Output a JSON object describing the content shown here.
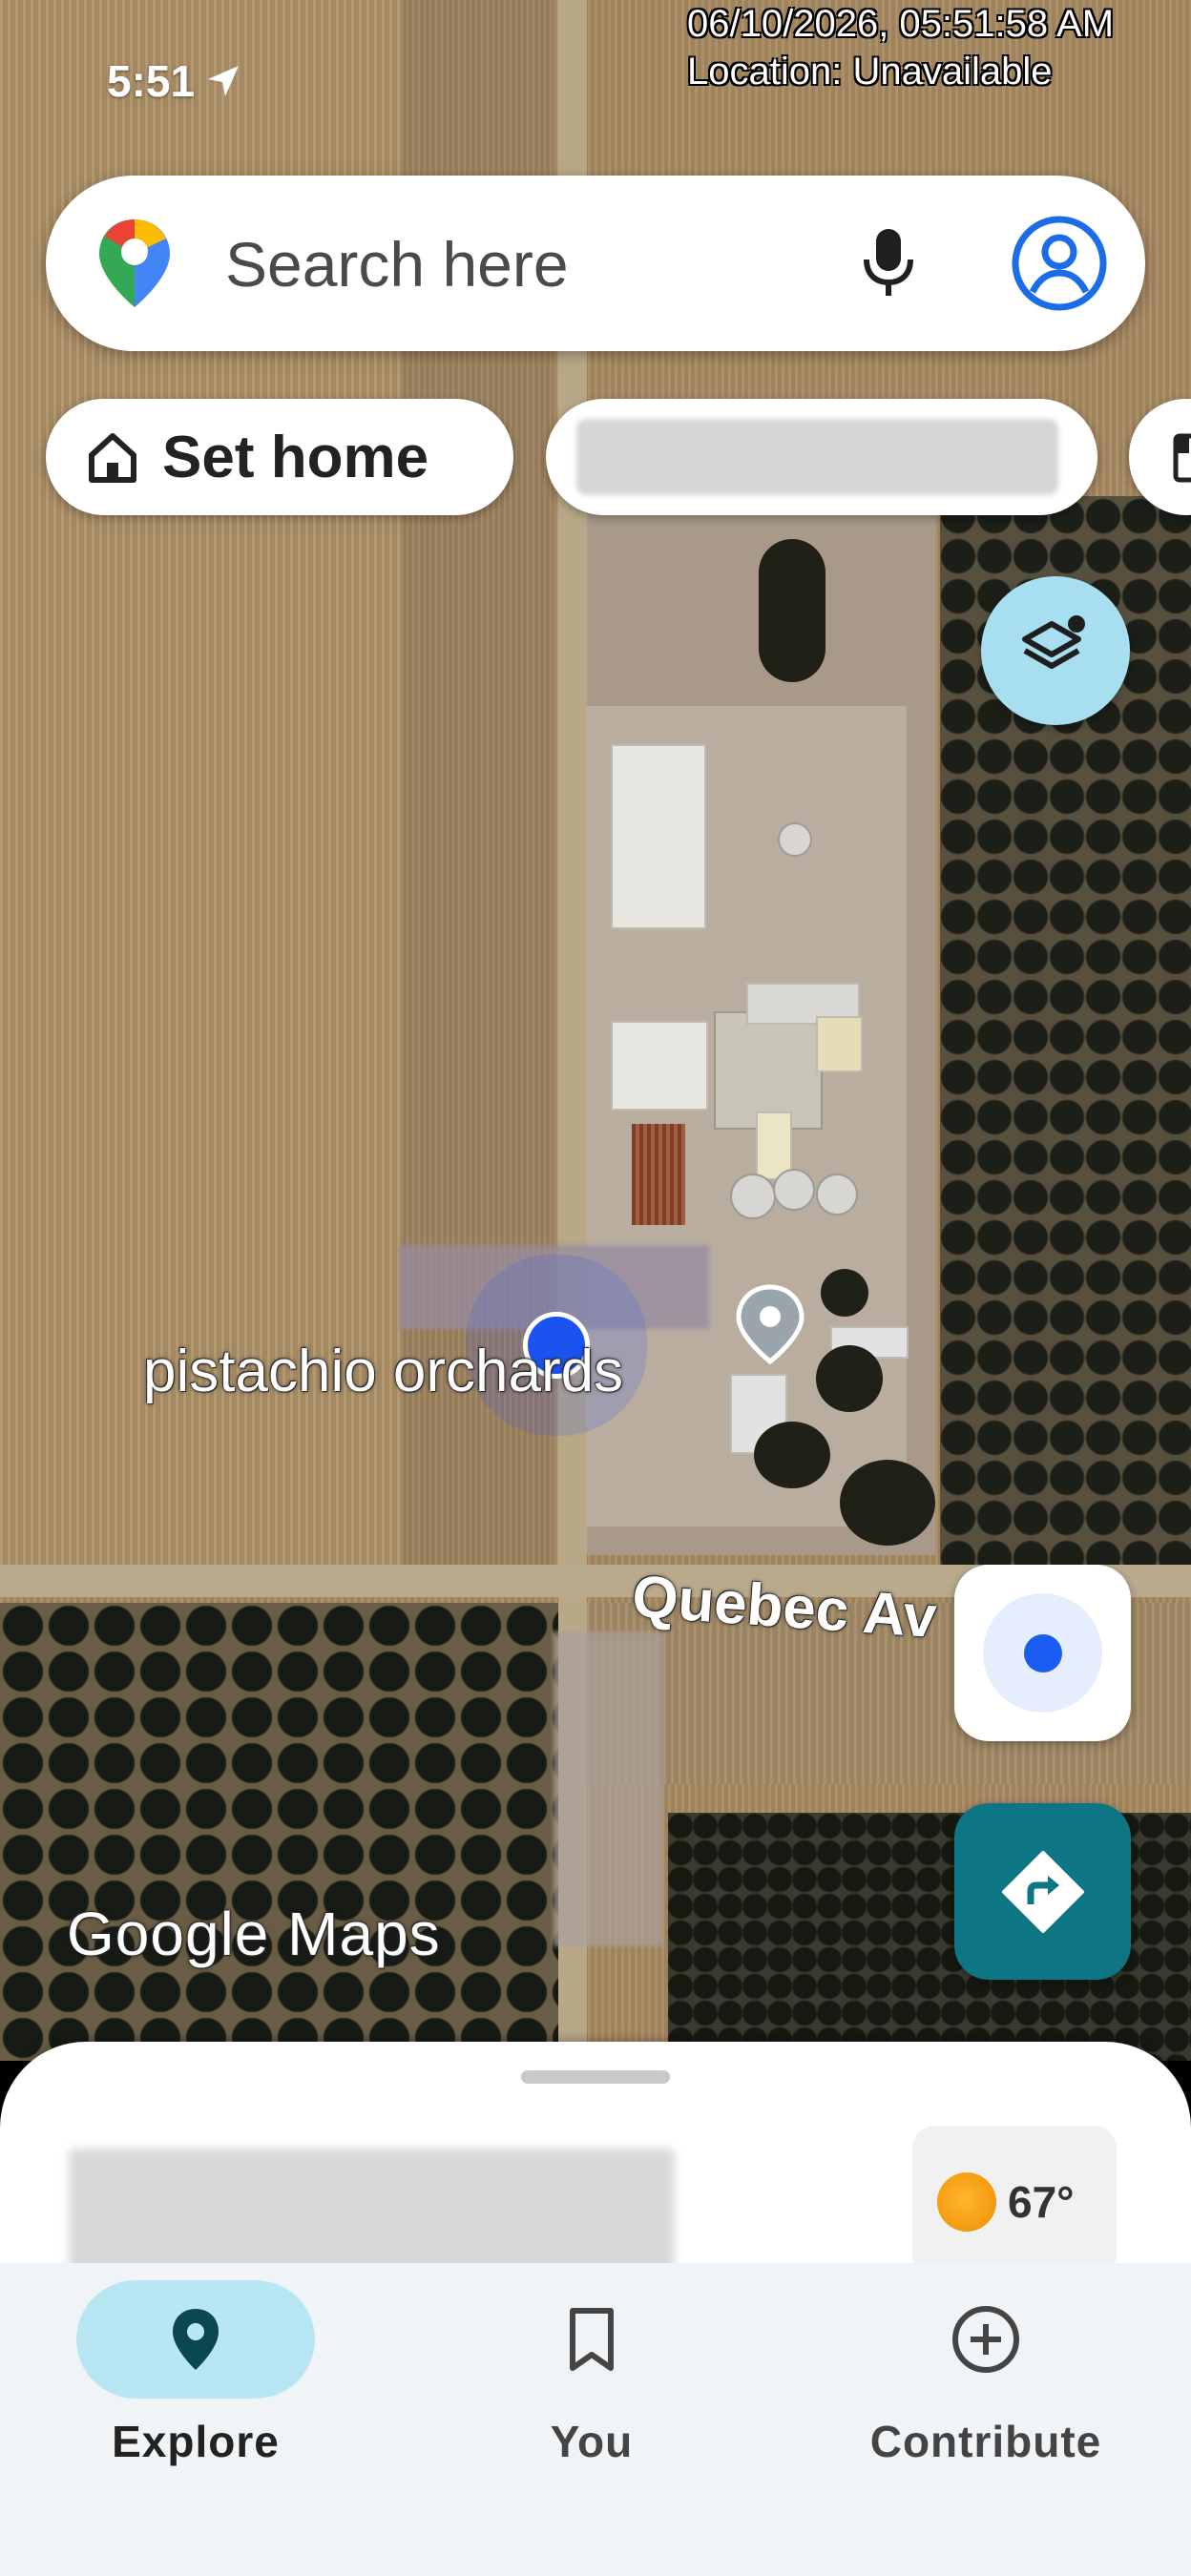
{
  "status_bar": {
    "time": "5:51"
  },
  "overlay": {
    "datetime": "06/10/2026, 05:51:58 AM",
    "location": "Location: Unavailable"
  },
  "search": {
    "placeholder": "Search here"
  },
  "chips": {
    "home_label": "Set home"
  },
  "map": {
    "place_label": "pistachio orchards",
    "street_label": "Quebec Av",
    "logo_text": "Google Maps"
  },
  "weather": {
    "temperature": "67°"
  },
  "nav": {
    "items": [
      {
        "label": "Explore",
        "icon": "explore-pin-icon",
        "active": true
      },
      {
        "label": "You",
        "icon": "bookmark-icon",
        "active": false
      },
      {
        "label": "Contribute",
        "icon": "add-circle-icon",
        "active": false
      }
    ]
  },
  "colors": {
    "accent": "#0e7585",
    "active_pill": "#b8e6f2",
    "location_blue": "#1a5cf0",
    "layers_button": "#a8dff0"
  }
}
